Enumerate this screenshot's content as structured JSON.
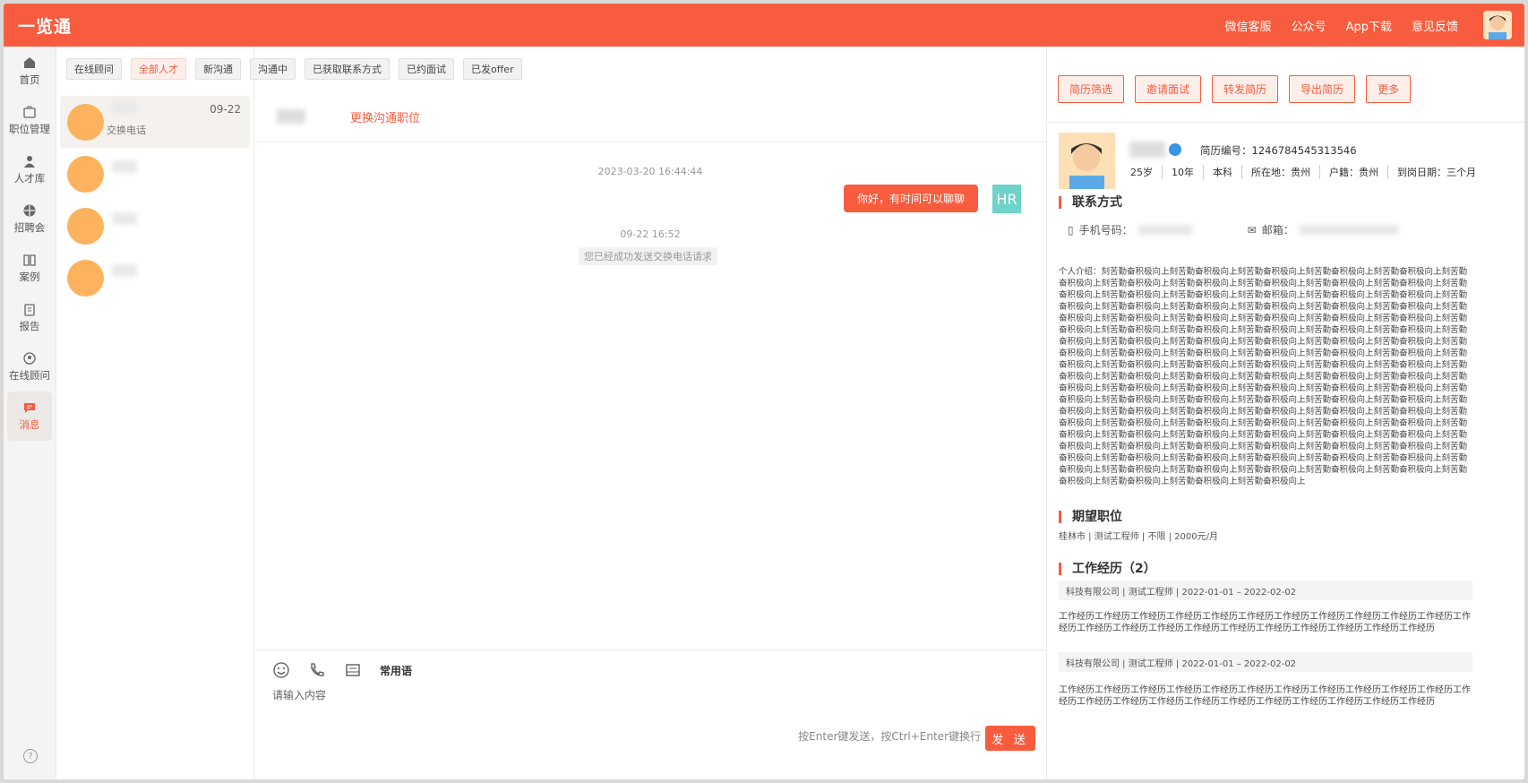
{
  "app": {
    "title": "一览通"
  },
  "top_links": [
    "微信客服",
    "公众号",
    "App下载",
    "意见反馈"
  ],
  "nav": [
    {
      "label": "首页",
      "icon": "home-icon"
    },
    {
      "label": "职位管理",
      "icon": "briefcase-icon"
    },
    {
      "label": "人才库",
      "icon": "person-icon"
    },
    {
      "label": "招聘会",
      "icon": "fan-icon"
    },
    {
      "label": "案例",
      "icon": "book-icon"
    },
    {
      "label": "报告",
      "icon": "clipboard-icon"
    },
    {
      "label": "在线顾问",
      "icon": "advisor-icon"
    },
    {
      "label": "消息",
      "icon": "message-icon"
    }
  ],
  "filters": [
    "在线顾问",
    "全部人才",
    "新沟通",
    "沟通中",
    "已获取联系方式",
    "已约面试",
    "已发offer"
  ],
  "contacts": [
    {
      "date": "09-22",
      "last_msg": "交换电话"
    },
    {
      "date": "",
      "last_msg": ""
    },
    {
      "date": "",
      "last_msg": ""
    },
    {
      "date": "",
      "last_msg": ""
    }
  ],
  "chat": {
    "change_job": "更换沟通职位",
    "ts1": "2023-03-20 16:44:44",
    "my_msg": "你好，有时间可以聊聊",
    "hr_label": "HR",
    "ts2": "09-22 16:52",
    "sys_msg": "您已经成功发送交换电话请求",
    "phrases": "常用语",
    "placeholder": "请输入内容",
    "hint": "按Enter键发送，按Ctrl+Enter键换行",
    "send": "发 送"
  },
  "actions": [
    "简历筛选",
    "邀请面试",
    "转发简历",
    "导出简历",
    "更多"
  ],
  "profile": {
    "resume_id": "简历编号：1246784545313546",
    "tags": [
      "25岁",
      "10年",
      "本科",
      "所在地：贵州",
      "户籍：贵州",
      "到岗日期：三个月"
    ]
  },
  "contact_section": {
    "title": "联系方式",
    "phone_label": "手机号码：",
    "email_label": "邮箱："
  },
  "intro": "个人介绍：刻苦勤奋积极向上刻苦勤奋积极向上刻苦勤奋积极向上刻苦勤奋积极向上刻苦勤奋积极向上刻苦勤奋积极向上刻苦勤奋积极向上刻苦勤奋积极向上刻苦勤奋积极向上刻苦勤奋积极向上刻苦勤奋积极向上刻苦勤奋积极向上刻苦勤奋积极向上刻苦勤奋积极向上刻苦勤奋积极向上刻苦勤奋积极向上刻苦勤奋积极向上刻苦勤奋积极向上刻苦勤奋积极向上刻苦勤奋积极向上刻苦勤奋积极向上刻苦勤奋积极向上刻苦勤奋积极向上刻苦勤奋积极向上刻苦勤奋积极向上刻苦勤奋积极向上刻苦勤奋积极向上刻苦勤奋积极向上刻苦勤奋积极向上刻苦勤奋积极向上刻苦勤奋积极向上刻苦勤奋积极向上刻苦勤奋积极向上刻苦勤奋积极向上刻苦勤奋积极向上刻苦勤奋积极向上刻苦勤奋积极向上刻苦勤奋积极向上刻苦勤奋积极向上刻苦勤奋积极向上刻苦勤奋积极向上刻苦勤奋积极向上刻苦勤奋积极向上刻苦勤奋积极向上刻苦勤奋积极向上刻苦勤奋积极向上刻苦勤奋积极向上刻苦勤奋积极向上刻苦勤奋积极向上刻苦勤奋积极向上刻苦勤奋积极向上刻苦勤奋积极向上刻苦勤奋积极向上刻苦勤奋积极向上刻苦勤奋积极向上刻苦勤奋积极向上刻苦勤奋积极向上刻苦勤奋积极向上刻苦勤奋积极向上刻苦勤奋积极向上刻苦勤奋积极向上刻苦勤奋积极向上刻苦勤奋积极向上刻苦勤奋积极向上刻苦勤奋积极向上刻苦勤奋积极向上刻苦勤奋积极向上刻苦勤奋积极向上刻苦勤奋积极向上刻苦勤奋积极向上刻苦勤奋积极向上刻苦勤奋积极向上刻苦勤奋积极向上刻苦勤奋积极向上刻苦勤奋积极向上刻苦勤奋积极向上刻苦勤奋积极向上刻苦勤奋积极向上刻苦勤奋积极向上刻苦勤奋积极向上刻苦勤奋积极向上刻苦勤奋积极向上刻苦勤奋积极向上刻苦勤奋积极向上刻苦勤奋积极向上刻苦勤奋积极向上刻苦勤奋积极向上刻苦勤奋积极向上刻苦勤奋积极向上刻苦勤奋积极向上刻苦勤奋积极向上刻苦勤奋积极向上刻苦勤奋积极向上刻苦勤奋积极向上刻苦勤奋积极向上刻苦勤奋积极向上刻苦勤奋积极向上刻苦勤奋积极向上刻苦勤奋积极向上刻苦勤奋积极向上刻苦勤奋积极向上刻苦勤奋积极向上刻苦勤奋积极向上刻苦勤奋积极向上刻苦勤奋积极向上刻苦勤奋积极向上刻苦勤奋积极向上刻苦勤奋积极向上刻苦勤奋积极向上刻苦勤奋积极向上刻苦勤奋积极向上",
  "want": {
    "title": "期望职位",
    "line": "桂林市  |  测试工程师  |  不限  |  2000元/月"
  },
  "work": {
    "title": "工作经历（2）",
    "items": [
      {
        "head": "科技有限公司  |  测试工程师  |  2022-01-01 – 2022-02-02",
        "desc": "工作经历工作经历工作经历工作经历工作经历工作经历工作经历工作经历工作经历工作经历工作经历工作经历工作经历工作经历工作经历工作经历工作经历工作经历工作经历工作经历工作经历工作经历"
      },
      {
        "head": "科技有限公司  |  测试工程师  |  2022-01-01 – 2022-02-02",
        "desc": "工作经历工作经历工作经历工作经历工作经历工作经历工作经历工作经历工作经历工作经历工作经历工作经历工作经历工作经历工作经历工作经历工作经历工作经历工作经历工作经历工作经历工作经历"
      }
    ]
  }
}
